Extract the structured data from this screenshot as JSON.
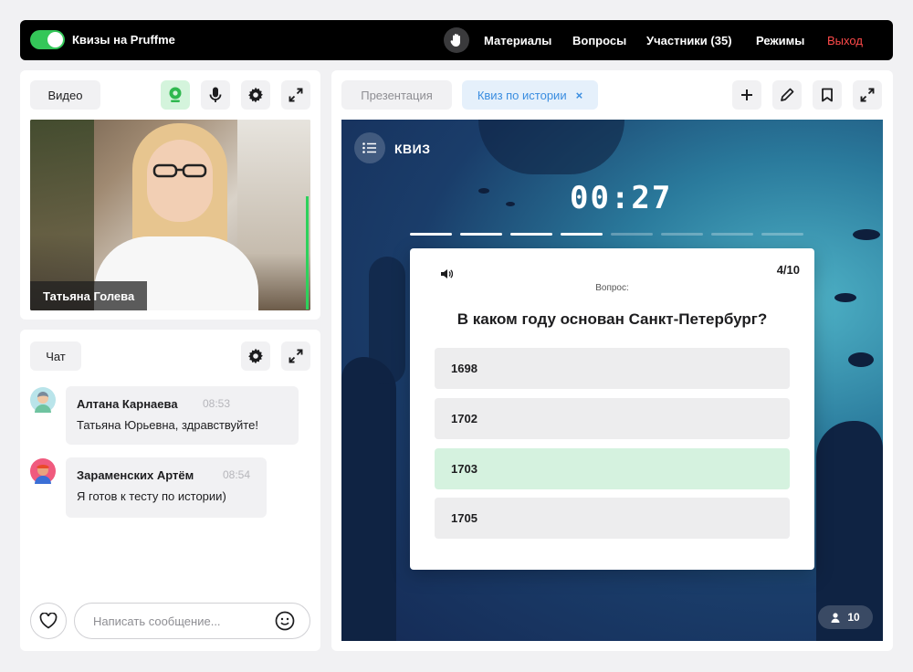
{
  "topbar": {
    "title": "Квизы на Pruffme",
    "nav": [
      "Материалы",
      "Вопросы",
      "Участники (35)",
      "Режимы"
    ],
    "exit": "Выход"
  },
  "video_panel": {
    "label": "Видео",
    "speaker_name": "Татьяна Голева"
  },
  "chat": {
    "label": "Чат",
    "messages": [
      {
        "name": "Алтана Карнаева",
        "time": "08:53",
        "text": "Татьяна Юрьевна, здравствуйте!"
      },
      {
        "name": "Зараменских Артём",
        "time": "08:54",
        "text": "Я готов к тесту по истории)"
      }
    ],
    "input_placeholder": "Написать сообщение..."
  },
  "tabs": {
    "presentation": "Презентация",
    "quiz": "Квиз по истории",
    "close": "×"
  },
  "quiz": {
    "label": "КВИЗ",
    "timer": "00:27",
    "progress": {
      "done": 4,
      "total": 10
    },
    "counter": "4/10",
    "caption": "Вопрос:",
    "question": "В каком году основан Санкт-Петербург?",
    "answers": [
      "1698",
      "1702",
      "1703",
      "1705"
    ],
    "correct_index": 2,
    "participants": "10"
  },
  "colors": {
    "accent_green": "#34c759",
    "exit_red": "#ff4a4a",
    "tab_blue": "#3a8de0",
    "correct_bg": "#d5f2df"
  }
}
